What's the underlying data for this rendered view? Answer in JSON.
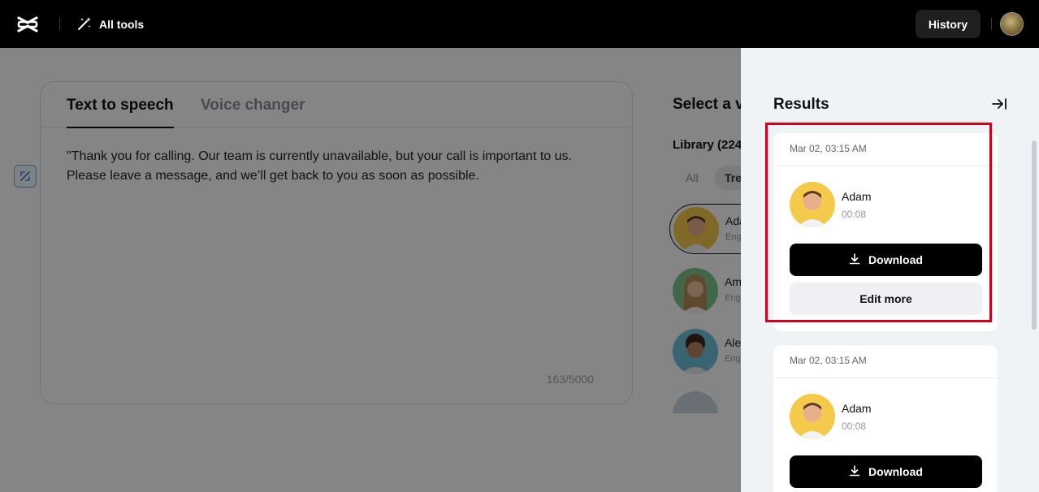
{
  "topbar": {
    "all_tools_label": "All tools",
    "history_label": "History"
  },
  "editor": {
    "tabs": [
      {
        "label": "Text to speech",
        "active": true
      },
      {
        "label": "Voice changer",
        "active": false
      }
    ],
    "text": "\"Thank you for calling. Our team is currently unavailable, but your call is important to us. Please leave a message, and we’ll get back to you as soon as possible.",
    "char_count": "163/5000"
  },
  "voice_panel": {
    "title": "Select a v",
    "library_label": "Library (224",
    "filters": [
      "All",
      "Tre"
    ],
    "voices": [
      {
        "name": "Ada",
        "lang": "Eng",
        "selected": true,
        "avatar_color": "#f5c94a"
      },
      {
        "name": "Am",
        "lang": "Eng",
        "selected": false,
        "avatar_color": "#7fc48a"
      },
      {
        "name": "Ale",
        "lang": "Eng",
        "selected": false,
        "avatar_color": "#6ec0d8"
      }
    ]
  },
  "results": {
    "title": "Results",
    "cards": [
      {
        "date": "Mar 02, 03:15 AM",
        "voice": "Adam",
        "duration": "00:08",
        "download_label": "Download",
        "edit_label": "Edit more"
      },
      {
        "date": "Mar 02, 03:15 AM",
        "voice": "Adam",
        "duration": "00:08",
        "download_label": "Download"
      }
    ]
  },
  "colors": {
    "highlight": "#d0021b",
    "topbar_bg": "#000000",
    "results_bg": "#f0f3f6"
  }
}
